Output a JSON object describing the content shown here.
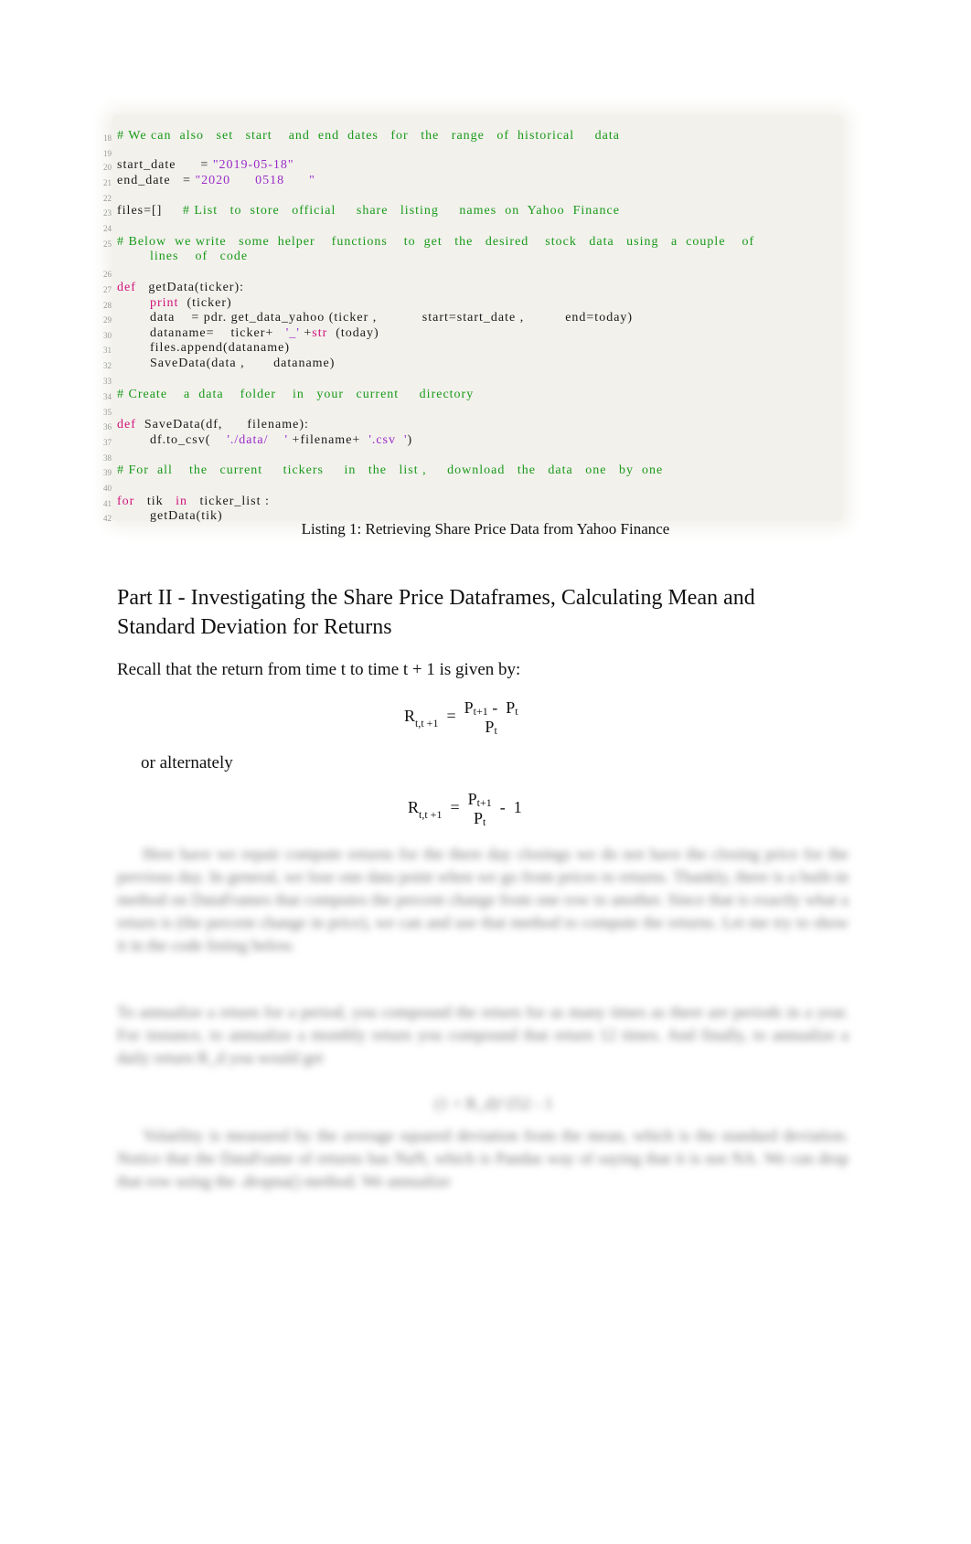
{
  "code": {
    "lines": [
      {
        "num": "18",
        "segments": [
          {
            "t": "cm",
            "v": "# We can  also   set   start    and  end  dates   for   the   range   of  historical     data"
          }
        ]
      },
      {
        "num": "19",
        "segments": []
      },
      {
        "num": "20",
        "segments": [
          {
            "t": "tx",
            "v": "start_date      = "
          },
          {
            "t": "st",
            "v": "\"2019-05-18\""
          }
        ]
      },
      {
        "num": "21",
        "segments": [
          {
            "t": "tx",
            "v": "end_date   = "
          },
          {
            "t": "st",
            "v": "\"2020      0518      \""
          }
        ]
      },
      {
        "num": "22",
        "segments": []
      },
      {
        "num": "23",
        "segments": [
          {
            "t": "tx",
            "v": "files=[]     "
          },
          {
            "t": "cm",
            "v": "# List   to  store   official     share   listing     names  on  Yahoo  Finance"
          }
        ]
      },
      {
        "num": "24",
        "segments": []
      },
      {
        "num": "25",
        "segments": [
          {
            "t": "cm",
            "v": "# Below  we write   some  helper    functions    to  get   the   desired    stock   data   using   a  couple    of"
          }
        ]
      },
      {
        "num": "",
        "indent": 1,
        "segments": [
          {
            "t": "cm",
            "v": "lines    of   code"
          }
        ]
      },
      {
        "num": "26",
        "segments": []
      },
      {
        "num": "27",
        "segments": [
          {
            "t": "kw",
            "v": "def"
          },
          {
            "t": "tx",
            "v": "   getData(ticker):"
          }
        ]
      },
      {
        "num": "28",
        "indent": 1,
        "segments": [
          {
            "t": "kw",
            "v": "print"
          },
          {
            "t": "tx",
            "v": "  (ticker)"
          }
        ]
      },
      {
        "num": "29",
        "indent": 1,
        "segments": [
          {
            "t": "tx",
            "v": "data    = pdr. get_data_yahoo (ticker ,           start=start_date ,          end=today)"
          }
        ]
      },
      {
        "num": "30",
        "indent": 1,
        "segments": [
          {
            "t": "tx",
            "v": "dataname=    ticker+   "
          },
          {
            "t": "st",
            "v": "'_'"
          },
          {
            "t": "tx",
            "v": " +"
          },
          {
            "t": "kw",
            "v": "str"
          },
          {
            "t": "tx",
            "v": "  (today)"
          }
        ]
      },
      {
        "num": "31",
        "indent": 1,
        "segments": [
          {
            "t": "tx",
            "v": "files.append(dataname)"
          }
        ]
      },
      {
        "num": "32",
        "indent": 1,
        "segments": [
          {
            "t": "tx",
            "v": "SaveData(data ,       dataname)"
          }
        ]
      },
      {
        "num": "33",
        "segments": []
      },
      {
        "num": "34",
        "segments": [
          {
            "t": "cm",
            "v": "# Create    a  data    folder    in   your   current     directory"
          }
        ]
      },
      {
        "num": "35",
        "segments": []
      },
      {
        "num": "36",
        "segments": [
          {
            "t": "kw",
            "v": "def"
          },
          {
            "t": "tx",
            "v": "  SaveData(df,      filename):"
          }
        ]
      },
      {
        "num": "37",
        "indent": 1,
        "segments": [
          {
            "t": "tx",
            "v": "df.to_csv(    "
          },
          {
            "t": "st",
            "v": "'./data/    '"
          },
          {
            "t": "tx",
            "v": " +filename+  "
          },
          {
            "t": "st",
            "v": "'.csv  '"
          },
          {
            "t": "tx",
            "v": ")"
          }
        ]
      },
      {
        "num": "38",
        "segments": []
      },
      {
        "num": "39",
        "segments": [
          {
            "t": "cm",
            "v": "# For  all    the   current     tickers     in   the   list ,     download   the   data   one   by  one"
          }
        ]
      },
      {
        "num": "40",
        "segments": []
      },
      {
        "num": "41",
        "segments": [
          {
            "t": "kw",
            "v": "for"
          },
          {
            "t": "tx",
            "v": "   tik   "
          },
          {
            "t": "kw",
            "v": "in"
          },
          {
            "t": "tx",
            "v": "   ticker_list :"
          }
        ]
      },
      {
        "num": "42",
        "indent": 1,
        "segments": [
          {
            "t": "tx",
            "v": "getData(tik)"
          }
        ]
      }
    ]
  },
  "caption": "Listing 1: Retrieving Share Price Data from Yahoo Finance",
  "section_heading": "Part II - Investigating the Share Price Dataframes, Calculating Mean and Standard Deviation for Returns",
  "recall_text": "Recall that the return from time    t to time  t + 1 is given by:",
  "formula1": {
    "lhs": "R",
    "lhs_sub": "t,t +1",
    "eq": "=",
    "num_a": "P",
    "num_a_sub": "t+1",
    "minus": "-",
    "num_b": "P",
    "num_b_sub": "t",
    "den": "P",
    "den_sub": "t"
  },
  "alternately_text": "or alternately",
  "formula2": {
    "lhs": "R",
    "lhs_sub": "t,t +1",
    "eq": "=",
    "num": "P",
    "num_sub": "t+1",
    "den": "P",
    "den_sub": "t",
    "minus": "-",
    "one": "1"
  },
  "blurred_para_1": "Here have we repair compute returns for the there day closings we do not have the closing price for the previous day. In general, we lose one data point when we go from prices to returns. Thankly, there is a built-in method on DataFrames that computes the percent change from one row to another. Since that is exactly what a return is (the percent change in price), we can and use that method to compute the returns. Let me try to show it in the code listing below.",
  "blurred_para_2": "To annualize a return for a period, you compound the return for as many times as there are periods in a year. For instance, to annualize a monthly return you compound that return 12 times. And finally, to annualize a daily return R_d you would get",
  "blurred_formula": "(1 + R_d)^252 - 1",
  "blurred_para_3": "Volatility is measured by the average squared deviation from the mean, which is the standard deviation. Notice that the DataFrame of returns has NaN, which is Pandas way of saying that it is not NA. We can drop that row using the .dropna() method. We annualize"
}
